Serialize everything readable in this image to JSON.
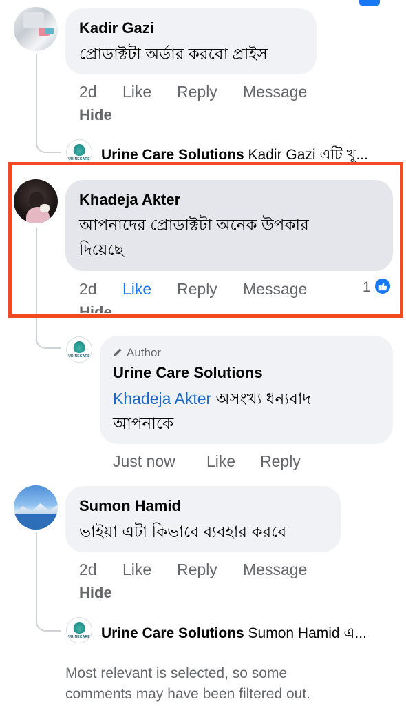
{
  "comments": [
    {
      "name": "Kadir Gazi",
      "text": "প্রোডাক্টটা অর্ডার করবো প্রাইস",
      "time": "2d",
      "like": "Like",
      "reply": "Reply",
      "message": "Message",
      "hide": "Hide",
      "page_reply": {
        "page_name": "Urine Care Solutions",
        "preview": "Kadir Gazi এটি খু..."
      }
    },
    {
      "name": "Khadeja Akter",
      "text_line1": "আপনাদের প্রোডাক্টটা অনেক উপকার",
      "text_line2": "দিয়েছে",
      "time": "2d",
      "like": "Like",
      "reply": "Reply",
      "message": "Message",
      "hide": "Hide",
      "reaction_count": "1"
    },
    {
      "name": "Sumon Hamid",
      "text": "ভাইয়া এটা কিভাবে ব্যবহার করবে",
      "time": "2d",
      "like": "Like",
      "reply": "Reply",
      "message": "Message",
      "hide": "Hide",
      "page_reply": {
        "page_name": "Urine Care Solutions",
        "preview": "Sumon Hamid এ..."
      }
    }
  ],
  "author_reply": {
    "badge": "Author",
    "name": "Urine Care Solutions",
    "mention": "Khadeja Akter",
    "text_after_mention": " অসংখ্য ধন্যবাদ",
    "text_line2": "আপনাকে",
    "time": "Just now",
    "like": "Like",
    "reply": "Reply"
  },
  "logo_text": "URINECARE",
  "footer": {
    "line1": "Most relevant is selected, so some",
    "line2": "comments may have been filtered out."
  },
  "colors": {
    "highlight_border": "#f24a22",
    "link_blue": "#1877f2",
    "mention_blue": "#1b6ac9"
  }
}
